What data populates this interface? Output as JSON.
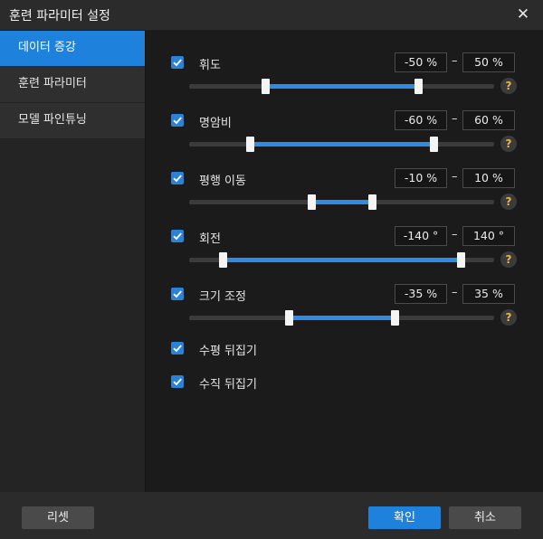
{
  "window": {
    "title": "훈련 파라미터 설정",
    "close_glyph": "✕"
  },
  "sidebar": {
    "items": [
      {
        "label": "데이터 증강",
        "active": true
      },
      {
        "label": "훈련 파라미터",
        "active": false
      },
      {
        "label": "모델 파인튜닝",
        "active": false
      }
    ]
  },
  "params": [
    {
      "label": "휘도",
      "checked": true,
      "min_text": "-50 %",
      "max_text": "50 %",
      "range_min": -100,
      "range_max": 100,
      "value_min": -50,
      "value_max": 50
    },
    {
      "label": "명암비",
      "checked": true,
      "min_text": "-60 %",
      "max_text": "60 %",
      "range_min": -100,
      "range_max": 100,
      "value_min": -60,
      "value_max": 60
    },
    {
      "label": "평행 이동",
      "checked": true,
      "min_text": "-10 %",
      "max_text": "10 %",
      "range_min": -50,
      "range_max": 50,
      "value_min": -10,
      "value_max": 10
    },
    {
      "label": "회전",
      "checked": true,
      "min_text": "-140 °",
      "max_text": "140 °",
      "range_min": -180,
      "range_max": 180,
      "value_min": -140,
      "value_max": 140
    },
    {
      "label": "크기 조정",
      "checked": true,
      "min_text": "-35 %",
      "max_text": "35 %",
      "range_min": -100,
      "range_max": 100,
      "value_min": -35,
      "value_max": 35
    }
  ],
  "flips": [
    {
      "label": "수평 뒤집기",
      "checked": true
    },
    {
      "label": "수직 뒤집기",
      "checked": true
    }
  ],
  "range_separator": "–",
  "help_glyph": "?",
  "footer": {
    "reset_label": "리셋",
    "ok_label": "확인",
    "cancel_label": "취소"
  },
  "colors": {
    "accent": "#1e82dc",
    "slider_fill": "#2f8ce6",
    "help_icon": "#f0b43c"
  }
}
